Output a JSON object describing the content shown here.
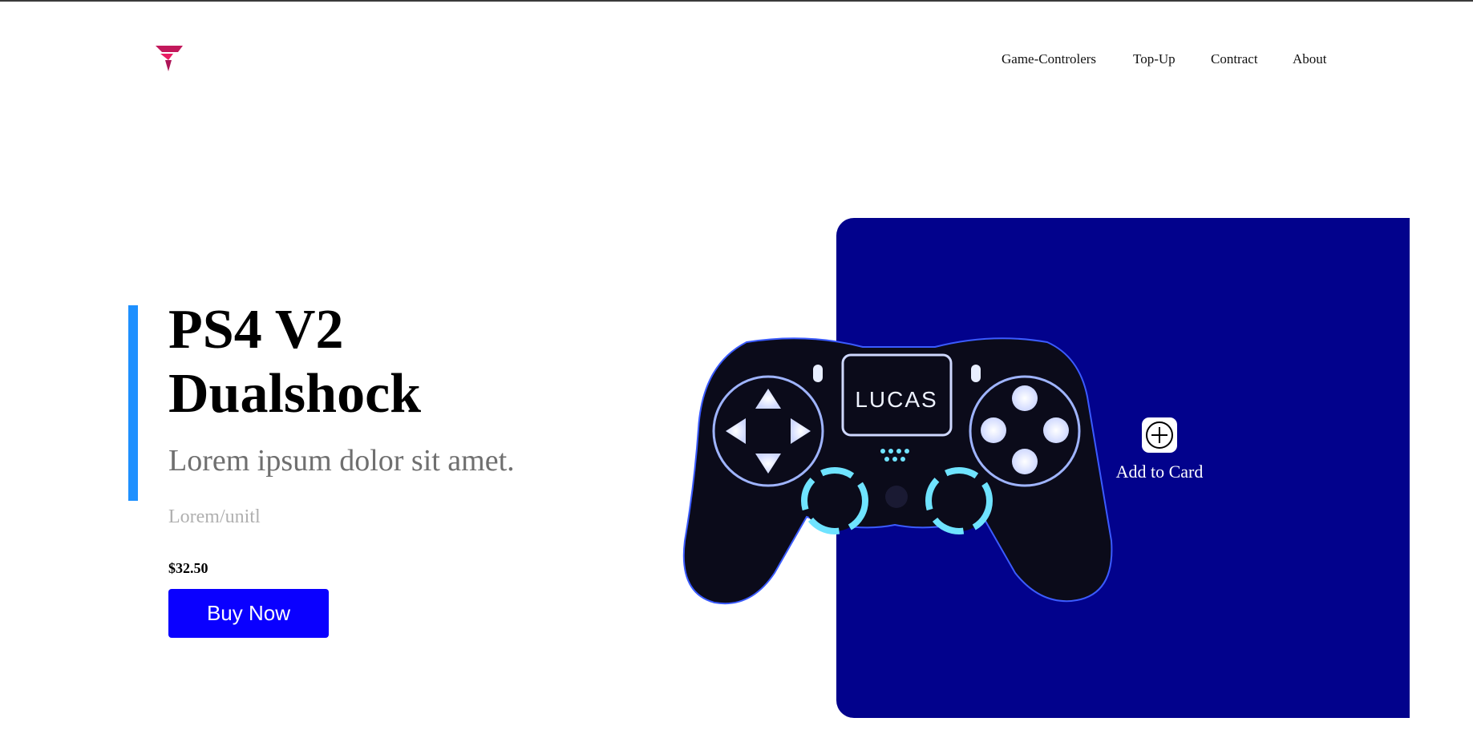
{
  "header": {
    "logo_icon": "brand-chevron-logo",
    "nav": [
      {
        "label": "Game-Controlers"
      },
      {
        "label": "Top-Up"
      },
      {
        "label": "Contract"
      },
      {
        "label": "About"
      }
    ]
  },
  "hero": {
    "title_line1": "PS4 V2",
    "title_line2": "Dualshock",
    "subtitle": "Lorem ipsum dolor sit amet.",
    "unit": "Lorem/unitl",
    "price": "$32.50",
    "buy_label": "Buy Now"
  },
  "product": {
    "controller_brand": "LUCAS",
    "add_icon": "plus-circle-icon",
    "add_label": "Add to Card"
  },
  "colors": {
    "accent": "#1e90ff",
    "button": "#0a00ff",
    "panel": "#02028c",
    "logo": "#c2185b"
  }
}
